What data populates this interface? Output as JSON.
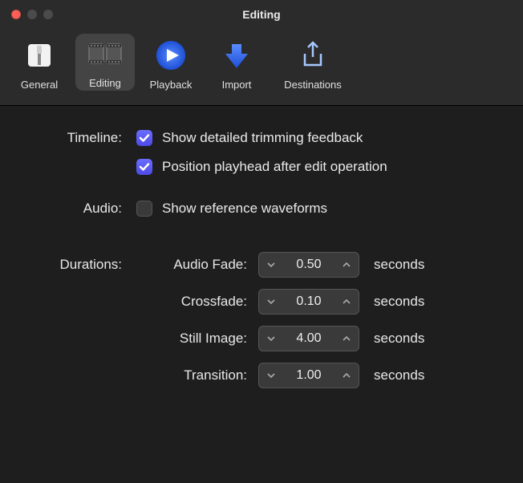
{
  "window": {
    "title": "Editing"
  },
  "toolbar": {
    "items": [
      {
        "label": "General"
      },
      {
        "label": "Editing"
      },
      {
        "label": "Playback"
      },
      {
        "label": "Import"
      },
      {
        "label": "Destinations"
      }
    ]
  },
  "timeline": {
    "section_label": "Timeline:",
    "opt1_label": "Show detailed trimming feedback",
    "opt1_checked": true,
    "opt2_label": "Position playhead after edit operation",
    "opt2_checked": true
  },
  "audio": {
    "section_label": "Audio:",
    "opt1_label": "Show reference waveforms",
    "opt1_checked": false
  },
  "durations": {
    "section_label": "Durations:",
    "unit": "seconds",
    "audio_fade": {
      "label": "Audio Fade:",
      "value": "0.50"
    },
    "crossfade": {
      "label": "Crossfade:",
      "value": "0.10"
    },
    "still_image": {
      "label": "Still Image:",
      "value": "4.00"
    },
    "transition": {
      "label": "Transition:",
      "value": "1.00"
    }
  }
}
